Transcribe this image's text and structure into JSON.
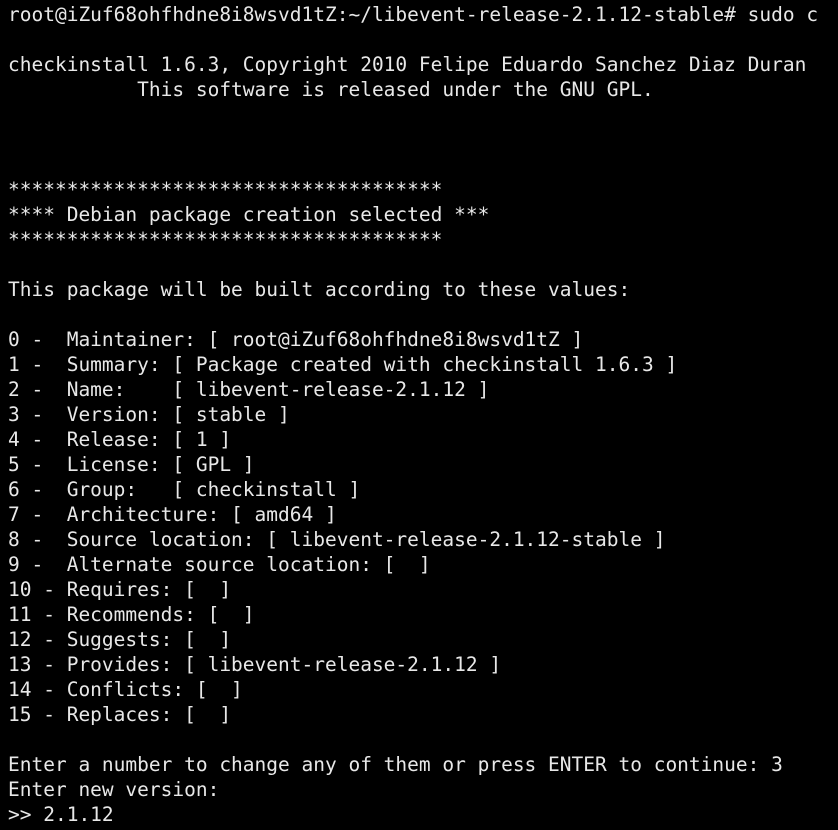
{
  "terminal": {
    "prompt": "root@iZuf68ohfhdne8i8wsvd1tZ:~/libevent-release-2.1.12-stable# sudo c",
    "banner_line1": "checkinstall 1.6.3, Copyright 2010 Felipe Eduardo Sanchez Diaz Duran",
    "banner_line2": "           This software is released under the GNU GPL.",
    "stars_top": "*************************************",
    "section_title": "**** Debian package creation selected ***",
    "stars_bottom": "*************************************",
    "intro": "This package will be built according to these values:",
    "values": [
      "0 -  Maintainer: [ root@iZuf68ohfhdne8i8wsvd1tZ ]",
      "1 -  Summary: [ Package created with checkinstall 1.6.3 ]",
      "2 -  Name:    [ libevent-release-2.1.12 ]",
      "3 -  Version: [ stable ]",
      "4 -  Release: [ 1 ]",
      "5 -  License: [ GPL ]",
      "6 -  Group:   [ checkinstall ]",
      "7 -  Architecture: [ amd64 ]",
      "8 -  Source location: [ libevent-release-2.1.12-stable ]",
      "9 -  Alternate source location: [  ]",
      "10 - Requires: [  ]",
      "11 - Recommends: [  ]",
      "12 - Suggests: [  ]",
      "13 - Provides: [ libevent-release-2.1.12 ]",
      "14 - Conflicts: [  ]",
      "15 - Replaces: [  ]"
    ],
    "question": "Enter a number to change any of them or press ENTER to continue: 3",
    "new_version_prompt": "Enter new version:",
    "input_line": ">> 2.1.12"
  },
  "colors": {
    "background": "#000000",
    "foreground": "#e8e8e8"
  }
}
